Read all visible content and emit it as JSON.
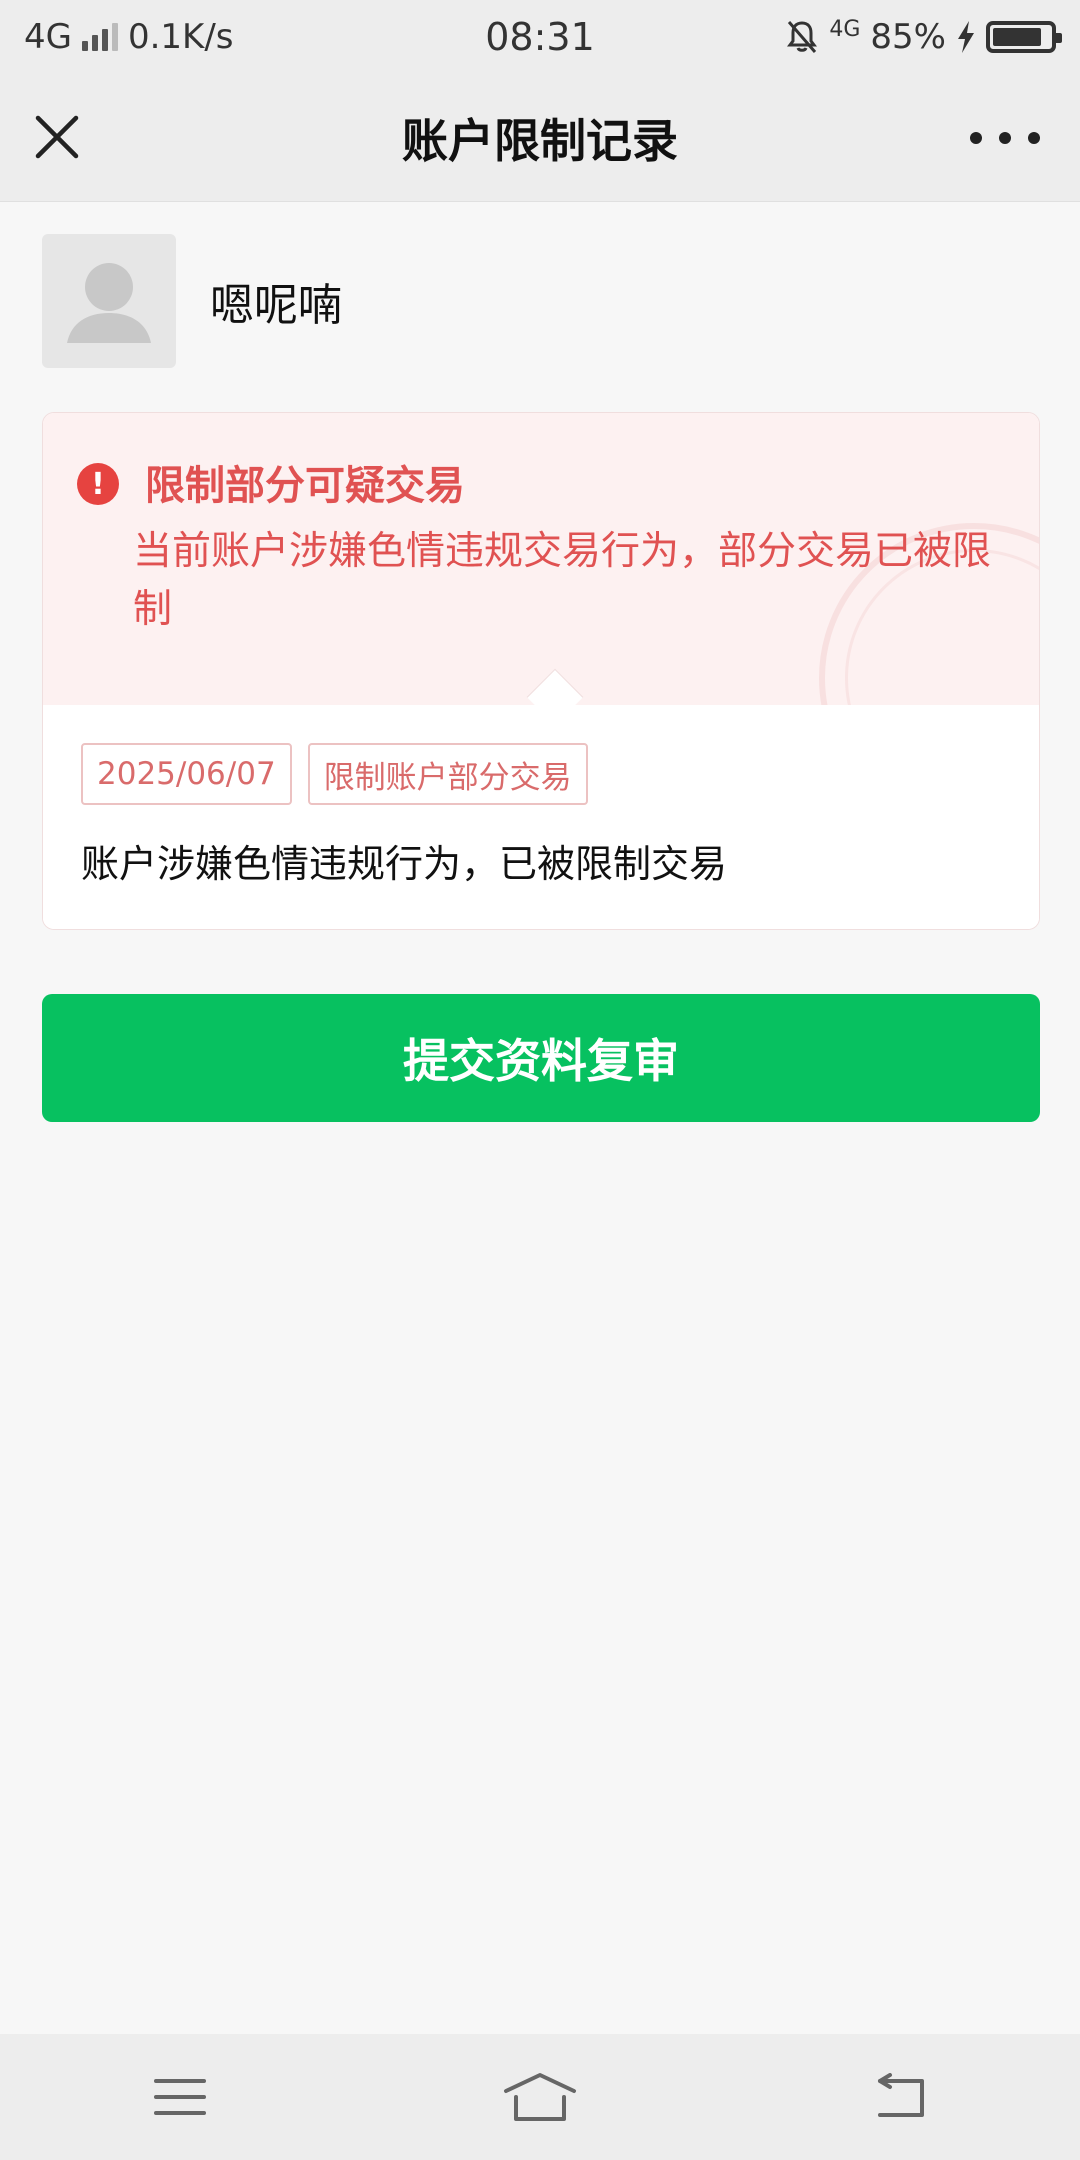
{
  "status_bar": {
    "network": "4G",
    "speed": "0.1K/s",
    "time": "08:31",
    "network_right": "4G",
    "battery": "85%",
    "battery_level": 0.85,
    "icons": [
      "signal-bars-icon",
      "mute-bell-icon",
      "charging-bolt-icon",
      "battery-icon"
    ]
  },
  "nav": {
    "title": "账户限制记录",
    "close_icon": "close-icon",
    "more_icon": "more-dots-icon"
  },
  "user": {
    "name": "嗯呢喃",
    "avatar_icon": "default-avatar-icon"
  },
  "alert": {
    "icon": "exclamation-icon",
    "title": "限制部分可疑交易",
    "description": "当前账户涉嫌色情违规交易行为，部分交易已被限制"
  },
  "record": {
    "date": "2025/06/07",
    "type_tag": "限制账户部分交易",
    "description": "账户涉嫌色情违规行为，已被限制交易"
  },
  "actions": {
    "submit_label": "提交资料复审"
  },
  "system_nav": {
    "icons": [
      "menu-icon",
      "home-icon",
      "back-icon"
    ]
  },
  "colors": {
    "accent_green": "#07c160",
    "alert_red": "#e05252",
    "alert_bg": "#fdf1f1",
    "bar_bg": "#ededed"
  }
}
